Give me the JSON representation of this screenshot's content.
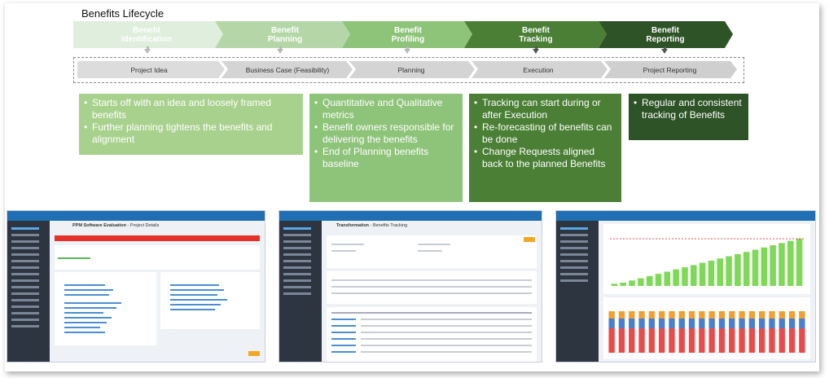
{
  "title": "Benefits Lifecycle",
  "stages": [
    {
      "line1": "Benefit",
      "line2": "Identification",
      "color": "#dfeedd"
    },
    {
      "line1": "Benefit",
      "line2": "Planning",
      "color": "#b5d7a8"
    },
    {
      "line1": "Benefit",
      "line2": "Profiling",
      "color": "#8ec37a"
    },
    {
      "line1": "Benefit",
      "line2": "Tracking",
      "color": "#4a7f35"
    },
    {
      "line1": "Benefit",
      "line2": "Reporting",
      "color": "#2d5326"
    }
  ],
  "phases": [
    "Project Idea",
    "Business Case (Feasibility)",
    "Planning",
    "Execution",
    "Project Reporting"
  ],
  "descriptions": [
    {
      "color": "#a9d18e",
      "bullets": [
        "Starts off with an idea and loosely framed benefits",
        "Further planning tightens the benefits and alignment"
      ]
    },
    {
      "color": "#8ec37a",
      "bullets": [
        "Quantitative and Qualitative metrics",
        "Benefit owners responsible for delivering the benefits",
        "End of Planning benefits baseline"
      ]
    },
    {
      "color": "#4a7f35",
      "bullets": [
        "Tracking can start during or after Execution",
        "Re-forecasting of benefits can be done",
        "Change Requests aligned back to the planned Benefits"
      ]
    },
    {
      "color": "#2d5326",
      "bullets": [
        "Regular and consistent tracking of Benefits"
      ]
    }
  ],
  "screenshots": [
    {
      "heading": "PPM Software Evaluation",
      "subheading": "Project Details"
    },
    {
      "heading": "Transformation",
      "subheading": "Benefits Tracking"
    },
    {
      "heading": "",
      "subheading": ""
    }
  ],
  "chart_data": {
    "type": "bar",
    "series": [
      {
        "values": [
          2,
          3,
          5,
          7,
          9,
          11,
          13,
          15,
          17,
          19,
          21,
          23,
          25,
          27,
          29,
          31,
          33,
          35,
          37,
          39,
          41,
          43
        ]
      }
    ]
  }
}
